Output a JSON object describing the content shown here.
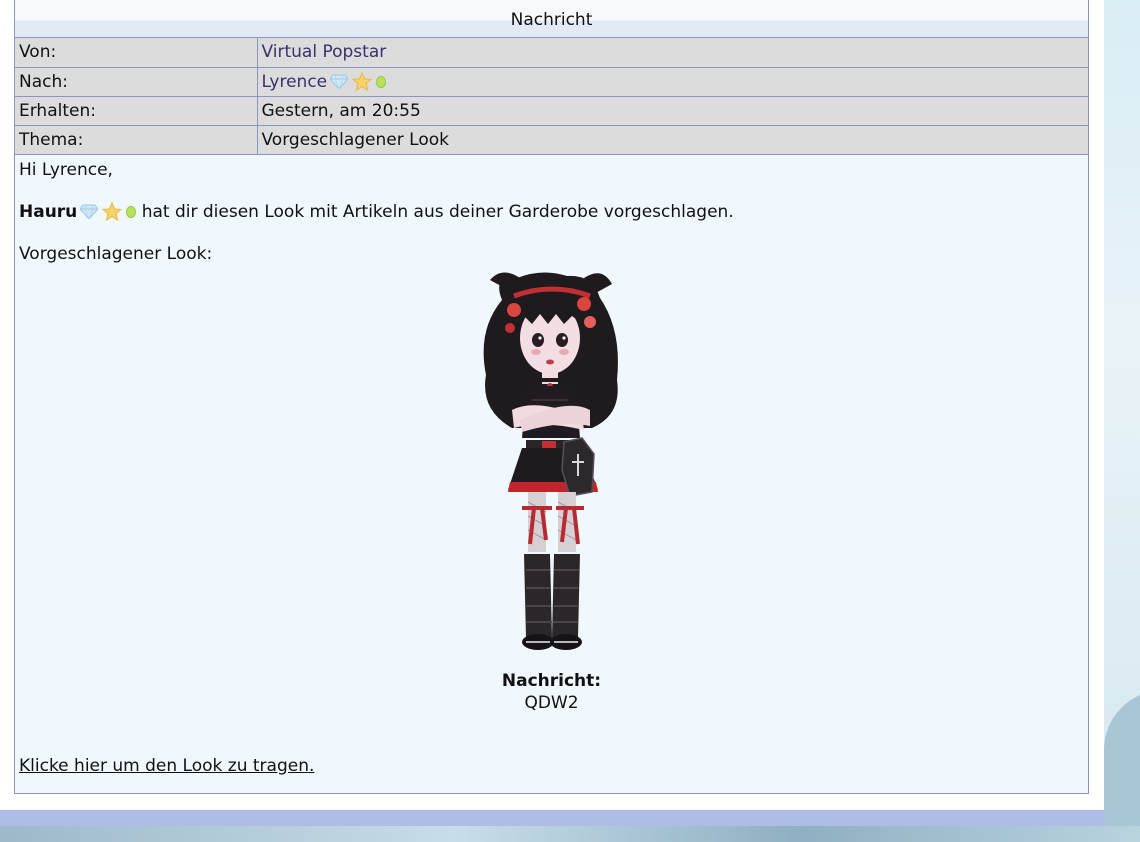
{
  "panel": {
    "title": "Nachricht"
  },
  "meta": {
    "from_label": "Von:",
    "from_value": "Virtual Popstar",
    "to_label": "Nach:",
    "to_value": "Lyrence",
    "received_label": "Erhalten:",
    "received_value": "Gestern, am 20:55",
    "subject_label": "Thema:",
    "subject_value": "Vorgeschlagener Look"
  },
  "message": {
    "greeting": "Hi Lyrence,",
    "sender_name": "Hauru",
    "suggestion_text": "hat dir diesen Look mit Artikeln aus deiner Garderobe vorgeschlagen.",
    "look_label": "Vorgeschlagener Look:",
    "note_label": "Nachricht:",
    "note_value": "QDW2",
    "wear_link": "Klicke hier um den Look zu tragen."
  },
  "icons": [
    "gem-icon",
    "star-icon",
    "online-dot-icon"
  ],
  "colors": {
    "link": "#3a2f6b",
    "meta_bg": "#dcdcdc",
    "body_bg": "#f0f8fd",
    "border": "#8a96bd"
  }
}
